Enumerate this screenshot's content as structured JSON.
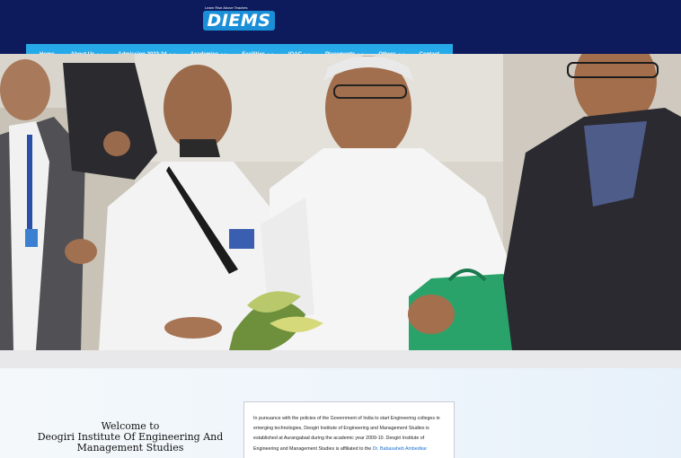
{
  "header": {
    "logo_text": "DIEMS",
    "logo_tagline": "Learn Rise Above Teaches"
  },
  "nav": {
    "items": [
      {
        "label": "Home",
        "dropdown": false
      },
      {
        "label": "About Us",
        "dropdown": true
      },
      {
        "label": "Admission 2023-24",
        "dropdown": true
      },
      {
        "label": "Academics",
        "dropdown": true
      },
      {
        "label": "Facilities",
        "dropdown": true
      },
      {
        "label": "IQAC",
        "dropdown": true
      },
      {
        "label": "Placements",
        "dropdown": true
      },
      {
        "label": "Others",
        "dropdown": true
      },
      {
        "label": "Contact",
        "dropdown": false
      }
    ]
  },
  "welcome": {
    "line1": "Welcome to",
    "line2": "Deogiri Institute Of Engineering And",
    "line3": "Management Studies",
    "paragraph": "In pursuance with the policies of the Government of India to start Engineering colleges in emerging technologies, Deogiri Institute of Engineering and Management Studies is established at Aurangabad during the academic year 2009-10. Deogiri Institute of Engineering and Management Studies is affiliated to the",
    "link_text": "Dr. Babasaheb Ambedkar"
  },
  "colors": {
    "header_bg": "#0d1a5c",
    "nav_bg": "#26a9e8",
    "logo_blue": "#1b8ed8"
  }
}
